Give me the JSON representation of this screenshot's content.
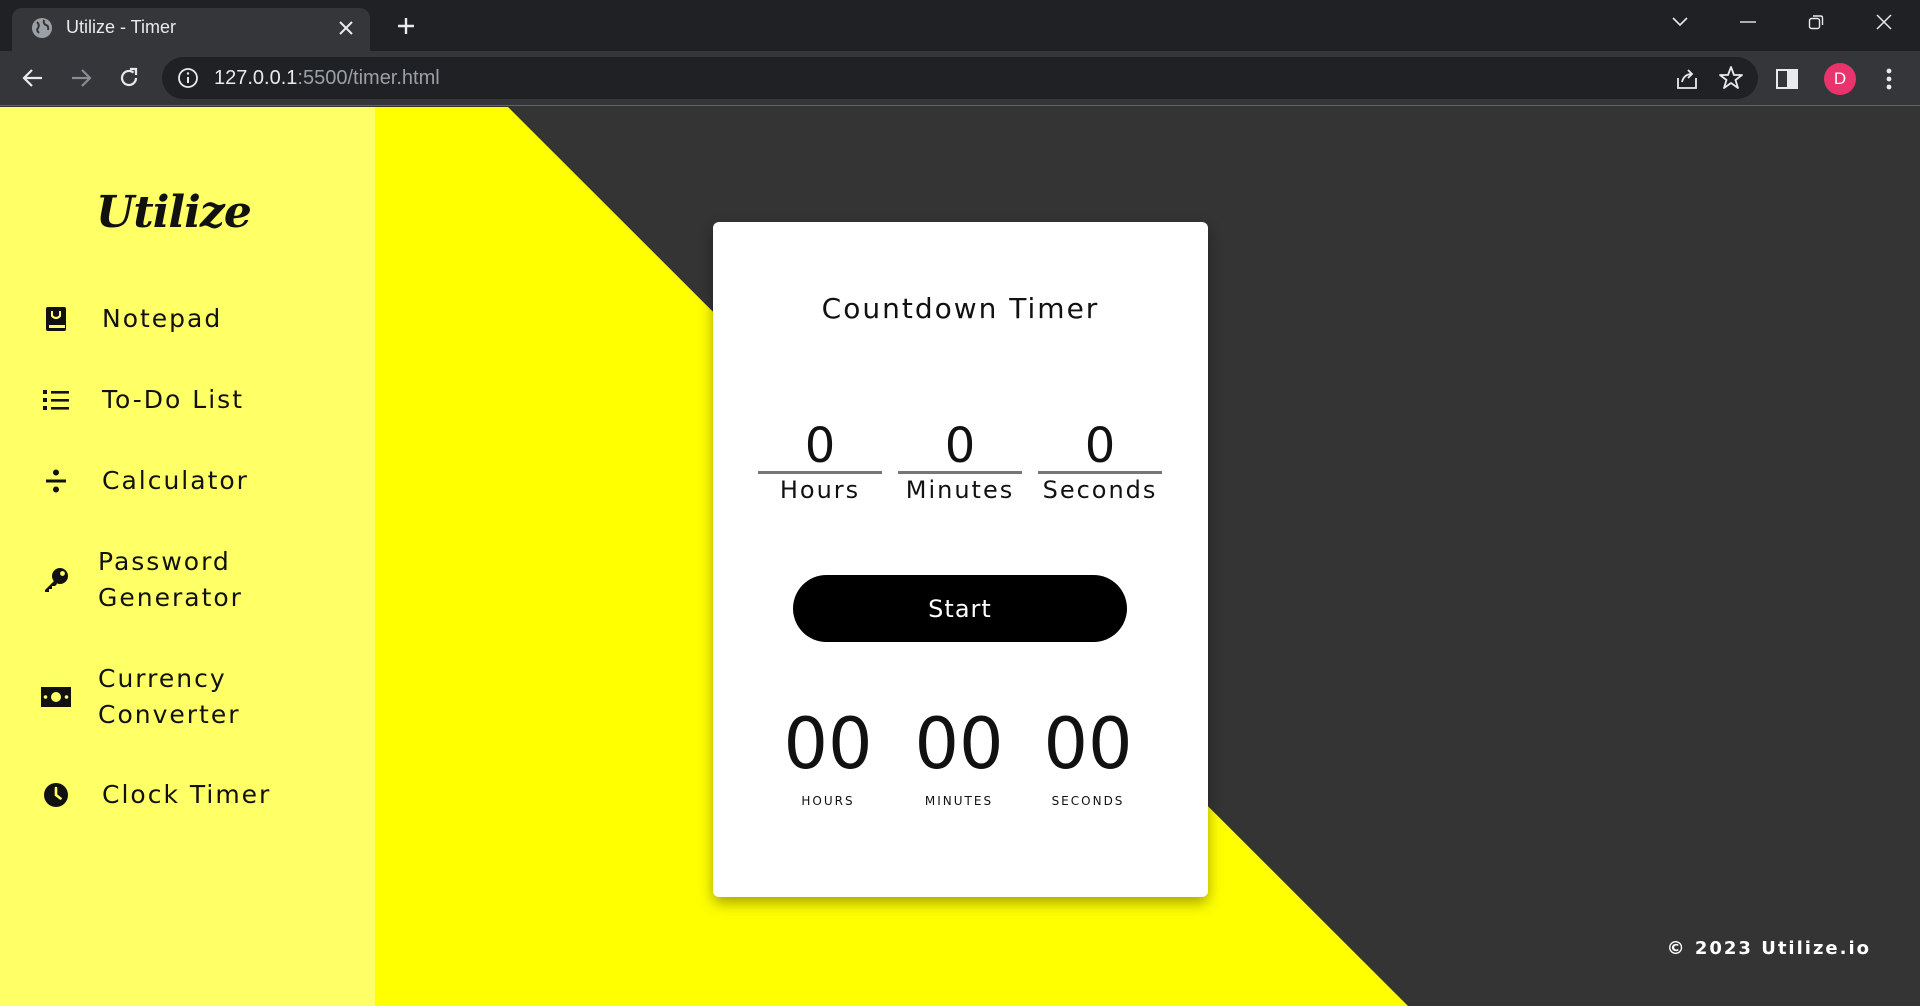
{
  "browser": {
    "tab_title": "Utilize - Timer",
    "url_host": "127.0.0.1",
    "url_path": ":5500/timer.html",
    "profile_initial": "D"
  },
  "colors": {
    "sidebar_bg": "#ffff66",
    "yellow": "#ffff00",
    "dark_bg": "#343434",
    "card_bg": "#ffffff",
    "button_bg": "#000000",
    "avatar": "#e8336d"
  },
  "sidebar": {
    "logo": "Utilize",
    "items": [
      {
        "icon": "notepad-icon",
        "line1": "Notepad",
        "line2": ""
      },
      {
        "icon": "list-icon",
        "line1": "To-Do List",
        "line2": ""
      },
      {
        "icon": "divide-icon",
        "line1": "Calculator",
        "line2": ""
      },
      {
        "icon": "key-icon",
        "line1": "Password",
        "line2": "Generator"
      },
      {
        "icon": "money-icon",
        "line1": "Currency",
        "line2": "Converter"
      },
      {
        "icon": "clock-icon",
        "line1": "Clock Timer",
        "line2": ""
      }
    ]
  },
  "timer": {
    "title": "Countdown Timer",
    "inputs": [
      {
        "value": "0",
        "label": "Hours"
      },
      {
        "value": "0",
        "label": "Minutes"
      },
      {
        "value": "0",
        "label": "Seconds"
      }
    ],
    "start_label": "Start",
    "display": [
      {
        "value": "00",
        "label": "HOURS"
      },
      {
        "value": "00",
        "label": "MINUTES"
      },
      {
        "value": "00",
        "label": "SECONDS"
      }
    ]
  },
  "footer": "© 2023 Utilize.io"
}
